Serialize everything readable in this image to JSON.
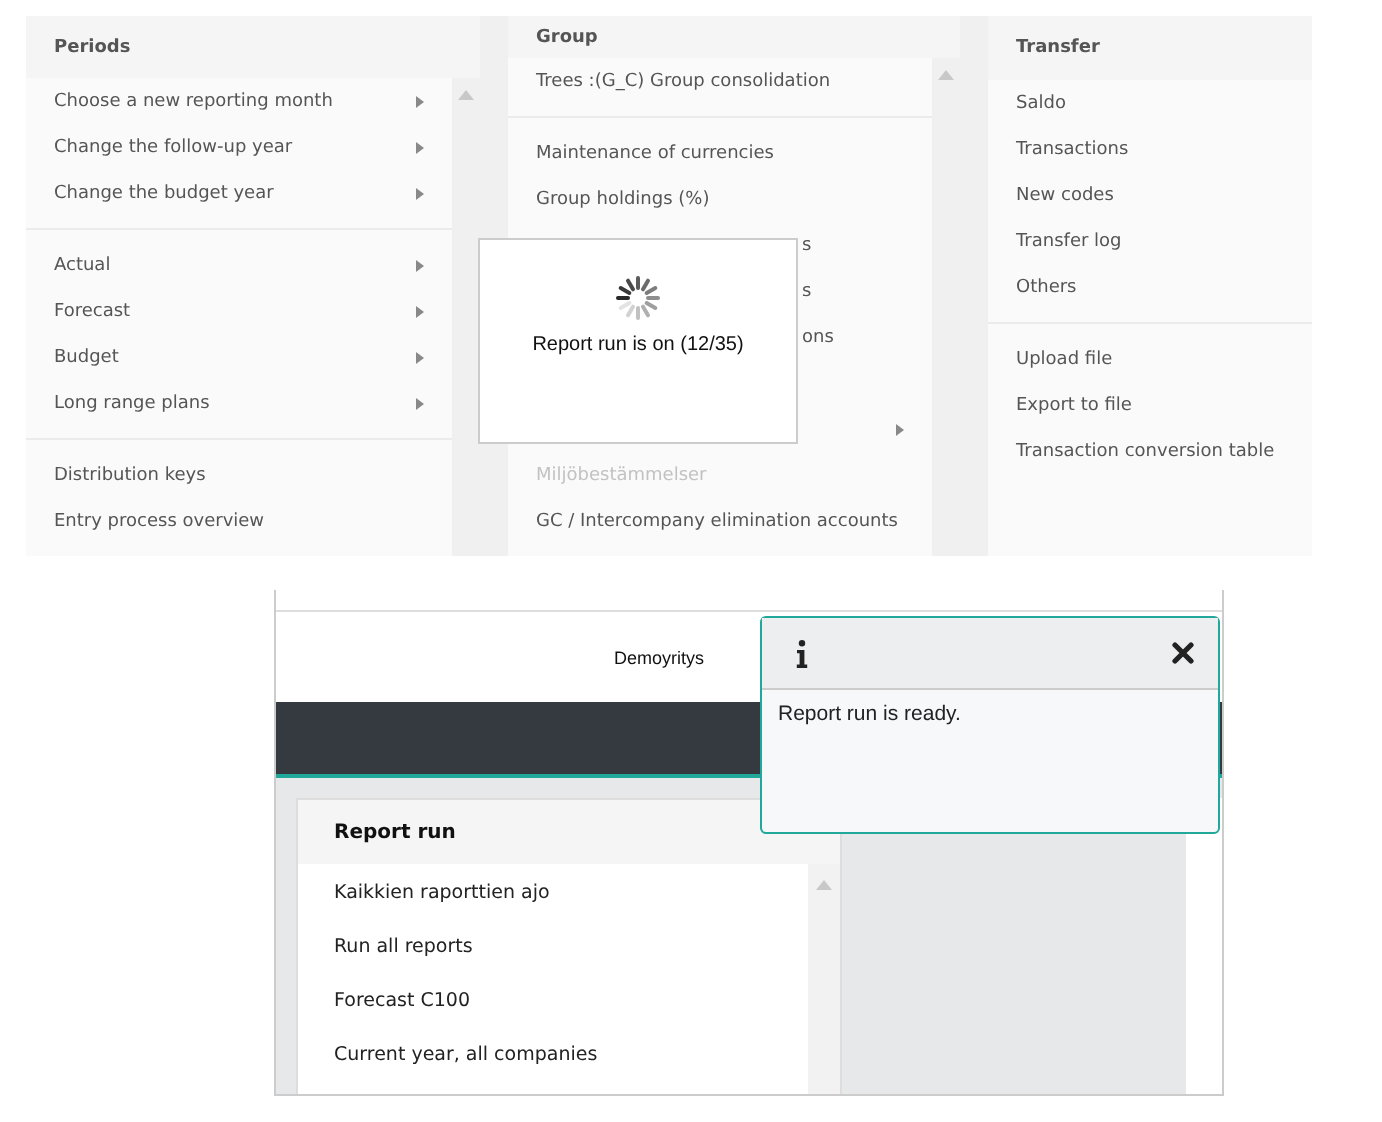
{
  "menu_columns": [
    {
      "title": "Periods",
      "scrollable": true,
      "groups": [
        [
          {
            "label": "Choose a new reporting month",
            "submenu": true,
            "disabled": false
          },
          {
            "label": "Change the follow-up year",
            "submenu": true,
            "disabled": false
          },
          {
            "label": "Change the budget year",
            "submenu": true,
            "disabled": false
          }
        ],
        [
          {
            "label": "Actual",
            "submenu": true,
            "disabled": false
          },
          {
            "label": "Forecast",
            "submenu": true,
            "disabled": false
          },
          {
            "label": "Budget",
            "submenu": true,
            "disabled": false
          },
          {
            "label": "Long range plans",
            "submenu": true,
            "disabled": false
          }
        ],
        [
          {
            "label": "Distribution keys",
            "submenu": false,
            "disabled": false
          },
          {
            "label": "Entry process overview",
            "submenu": false,
            "disabled": false
          }
        ]
      ]
    },
    {
      "title": "Group",
      "scrollable": true,
      "groups": [
        [
          {
            "label": "Trees :(G_C) Group consolidation",
            "submenu": false,
            "disabled": false
          }
        ],
        [
          {
            "label": "Maintenance of currencies",
            "submenu": false,
            "disabled": false
          },
          {
            "label": "Group holdings (%)",
            "submenu": false,
            "disabled": false
          },
          {
            "kind": "covered",
            "label": "s",
            "submenu": false,
            "disabled": false
          },
          {
            "kind": "covered",
            "label": "s",
            "submenu": false,
            "disabled": false
          },
          {
            "kind": "covered",
            "label": "ons",
            "submenu": false,
            "disabled": false
          },
          {
            "kind": "covered",
            "submenu": true,
            "disabled": false
          },
          {
            "label": "Miljöbestämmelser",
            "submenu": false,
            "disabled": true
          },
          {
            "label": "GC / Intercompany elimination accounts",
            "submenu": false,
            "disabled": false
          }
        ]
      ]
    },
    {
      "title": "Transfer",
      "scrollable": false,
      "groups": [
        [
          {
            "label": "Saldo",
            "submenu": false,
            "disabled": false
          },
          {
            "label": "Transactions",
            "submenu": false,
            "disabled": false
          },
          {
            "label": "New codes",
            "submenu": false,
            "disabled": false
          },
          {
            "label": "Transfer log",
            "submenu": false,
            "disabled": false
          },
          {
            "label": "Others",
            "submenu": false,
            "disabled": false
          }
        ],
        [
          {
            "label": "Upload file",
            "submenu": false,
            "disabled": false
          },
          {
            "label": "Export to file",
            "submenu": false,
            "disabled": false
          },
          {
            "label": "Transaction conversion table",
            "submenu": false,
            "disabled": false
          }
        ]
      ]
    }
  ],
  "progress_dialog": {
    "message": "Report run is on (12/35)"
  },
  "app_header": {
    "company": "Demoyritys"
  },
  "report_panel": {
    "title": "Report run",
    "items": [
      "Kaikkien raporttien ajo",
      "Run all reports",
      "Forecast C100",
      "Current year, all companies"
    ]
  },
  "notification": {
    "message": "Report run is ready."
  }
}
